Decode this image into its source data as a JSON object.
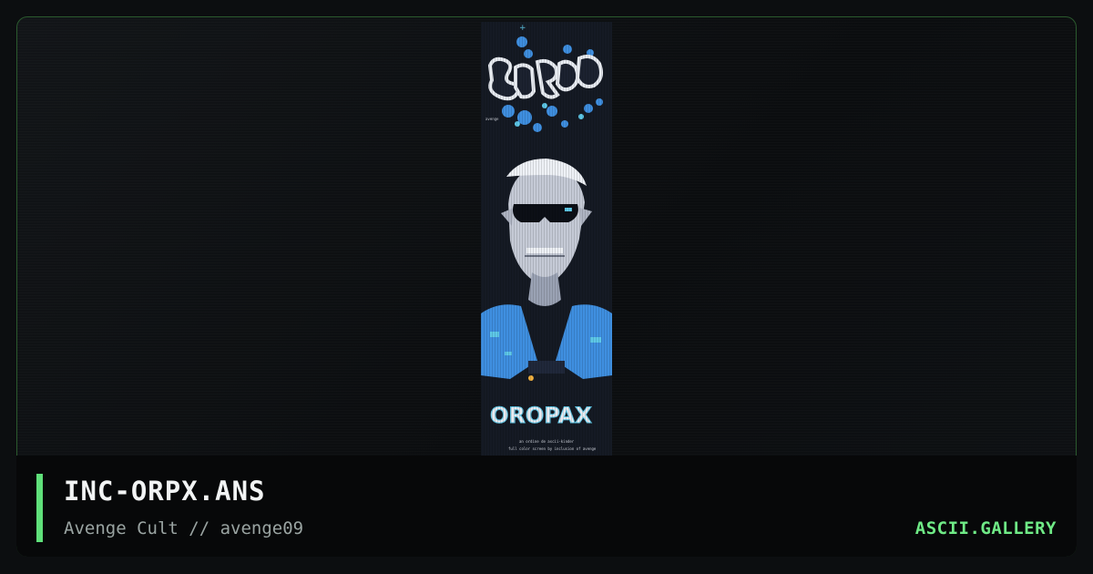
{
  "artwork": {
    "filename": "INC-ORPX.ANS",
    "credit": "Avenge Cult // avenge09",
    "logo_top_text": "avenge",
    "logo_bottom_text": "OROPAX",
    "caption_line1": "an ordine de ascii-kinder",
    "caption_line2": "full color screen by inclusion of avenge"
  },
  "brand": {
    "label": "ASCII.GALLERY"
  },
  "colors": {
    "accent": "#5fe07a",
    "brand": "#6fea86",
    "frame_border": "#2b5a2e",
    "art_blue": "#3f8fe0",
    "art_cyan": "#5ec8e8"
  }
}
